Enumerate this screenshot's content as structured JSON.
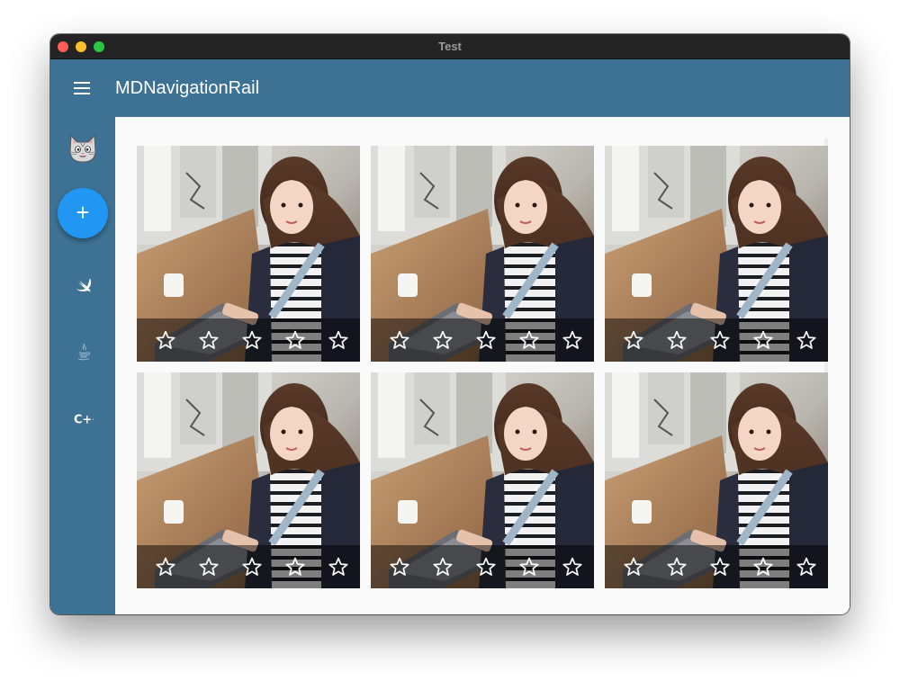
{
  "window": {
    "title": "Test"
  },
  "toolbar": {
    "title": "MDNavigationRail",
    "menu_icon": "menu-icon"
  },
  "rail": {
    "avatar_icon": "cat-avatar-icon",
    "fab_icon": "plus-icon",
    "items": [
      {
        "name": "swift",
        "icon": "swift-icon"
      },
      {
        "name": "java",
        "icon": "java-icon"
      },
      {
        "name": "cpp",
        "icon": "cpp-icon",
        "label": "C++"
      }
    ]
  },
  "colors": {
    "toolbar": "#3e7294",
    "rail": "#3e7294",
    "fab": "#2196f3",
    "content_background": "#fafafa",
    "titlebar": "#242424"
  },
  "gallery": {
    "rows": 2,
    "columns": 3,
    "tiles": [
      {
        "stars": 5,
        "filled": 0
      },
      {
        "stars": 5,
        "filled": 0
      },
      {
        "stars": 5,
        "filled": 0
      },
      {
        "stars": 5,
        "filled": 0
      },
      {
        "stars": 5,
        "filled": 0
      },
      {
        "stars": 5,
        "filled": 0
      }
    ],
    "star_icon": "star-outline-icon"
  }
}
